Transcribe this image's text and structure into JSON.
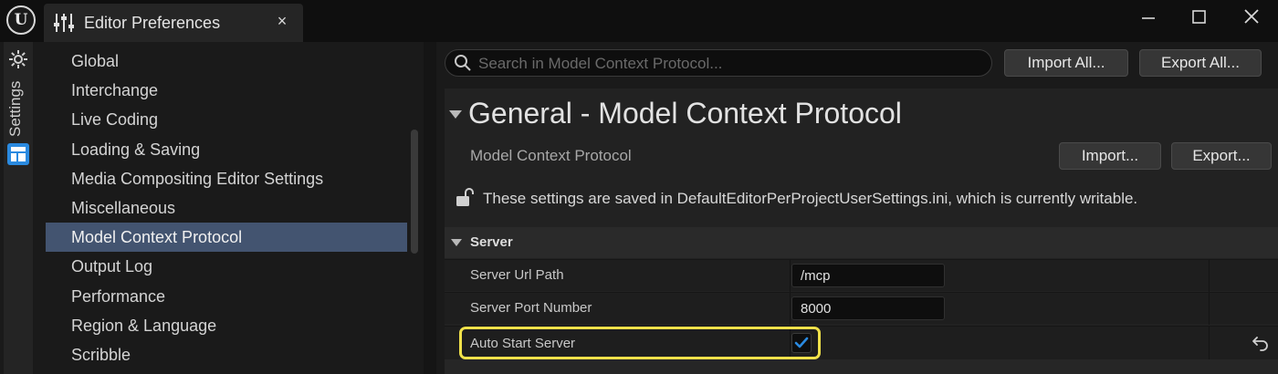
{
  "window": {
    "tab_title": "Editor Preferences",
    "close_glyph": "×",
    "logo_glyph": "U",
    "controls": [
      "minimize-icon",
      "maximize-icon",
      "close-icon"
    ]
  },
  "sidebar": {
    "label": "Settings",
    "icons": [
      "gear-icon",
      "layout-icon"
    ],
    "accent_color": "#2a8ae0"
  },
  "categories": {
    "items": [
      "Global",
      "Interchange",
      "Live Coding",
      "Loading & Saving",
      "Media Compositing Editor Settings",
      "Miscellaneous",
      "Model Context Protocol",
      "Output Log",
      "Performance",
      "Region & Language",
      "Scribble"
    ],
    "selected": "Model Context Protocol",
    "selected_color": "#435470"
  },
  "toolbar": {
    "search_placeholder": "Search in Model Context Protocol...",
    "import_all_label": "Import All...",
    "export_all_label": "Export All..."
  },
  "section": {
    "title": "General - Model Context Protocol",
    "subtitle": "Model Context Protocol",
    "import_label": "Import...",
    "export_label": "Export...",
    "save_note": "These settings are saved in DefaultEditorPerProjectUserSettings.ini, which is currently writable."
  },
  "server": {
    "category_label": "Server",
    "properties": [
      {
        "name": "Server Url Path",
        "value": "/mcp"
      },
      {
        "name": "Server Port Number",
        "value": "8000"
      },
      {
        "name": "Auto Start Server",
        "checked": true
      }
    ],
    "highlight_color": "#f0e14a",
    "checkbox_color": "#2a8ae0"
  }
}
